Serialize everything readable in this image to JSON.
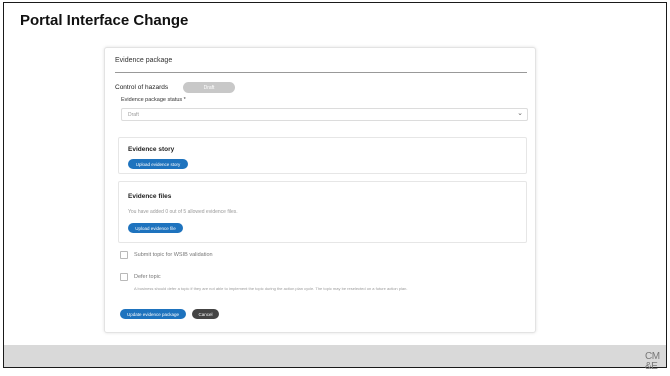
{
  "slide": {
    "title": "Portal Interface Change",
    "logo_line1": "CM",
    "logo_line2": "&E"
  },
  "panel": {
    "title": "Evidence package",
    "control_label": "Control of hazards",
    "control_badge": "Draft",
    "status_label": "Evidence package status *",
    "status_value": "Draft"
  },
  "story": {
    "title": "Evidence story",
    "button": "Upload evidence story"
  },
  "files": {
    "title": "Evidence files",
    "note": "You have added 0 out of 5 allowed evidence files.",
    "button": "Upload evidence file"
  },
  "options": {
    "submit_label": "Submit topic for WSIB validation",
    "defer_label": "Defer topic",
    "defer_desc": "A business should defer a topic if they are not able to implement the topic during the action plan cycle. The topic may be reselected on a future action plan."
  },
  "actions": {
    "update": "Update evidence package",
    "cancel": "Cancel"
  },
  "colors": {
    "primary_button": "#1e73be",
    "cancel_button": "#444444",
    "draft_badge": "#c8c8c8"
  },
  "icons": {
    "status_dropdown": "chevron-down-icon"
  }
}
